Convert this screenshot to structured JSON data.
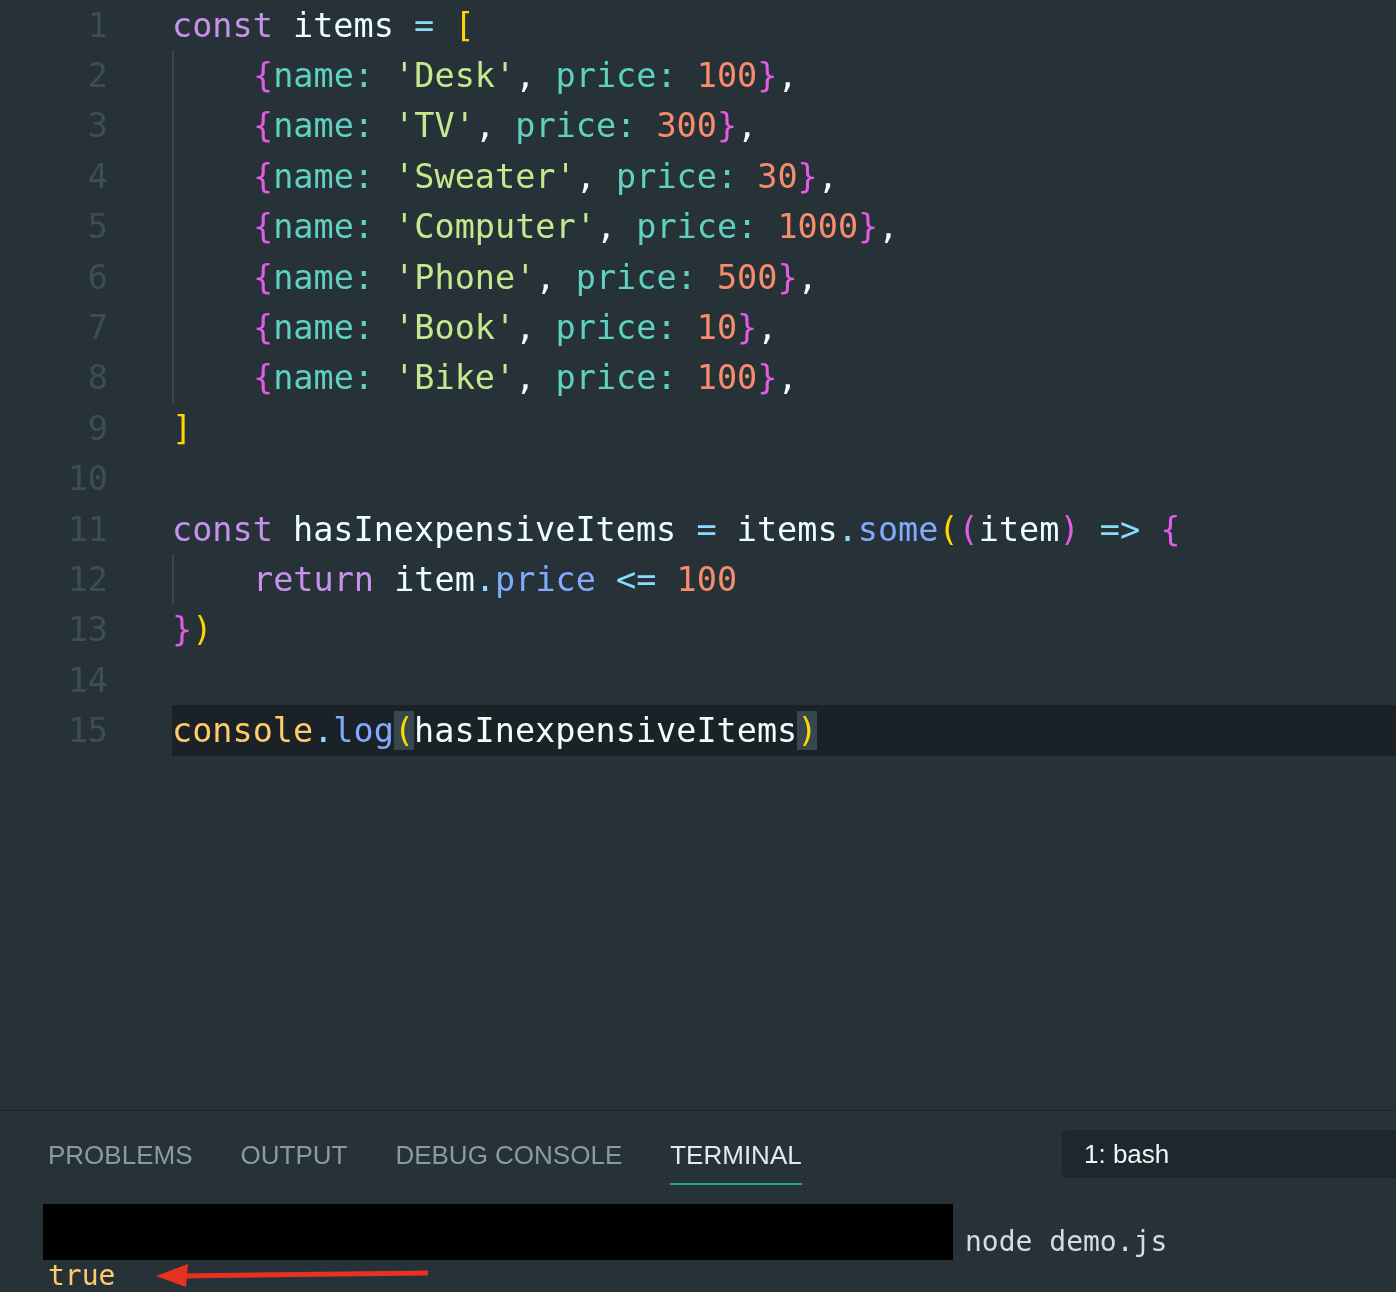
{
  "editor": {
    "lines": [
      {
        "number": "1",
        "current": false,
        "indented": false,
        "tokens": [
          {
            "text": "const ",
            "kind": "keyword"
          },
          {
            "text": "items ",
            "kind": "variable"
          },
          {
            "text": "= ",
            "kind": "operator"
          },
          {
            "text": "[",
            "kind": "bracket-yellow"
          }
        ]
      },
      {
        "number": "2",
        "current": false,
        "indented": true,
        "tokens": [
          {
            "text": "{",
            "kind": "bracket-pink"
          },
          {
            "text": "name: ",
            "kind": "property"
          },
          {
            "text": "'Desk'",
            "kind": "string"
          },
          {
            "text": ", ",
            "kind": "punct"
          },
          {
            "text": "price: ",
            "kind": "property"
          },
          {
            "text": "100",
            "kind": "number"
          },
          {
            "text": "}",
            "kind": "bracket-pink"
          },
          {
            "text": ",",
            "kind": "punct"
          }
        ]
      },
      {
        "number": "3",
        "current": false,
        "indented": true,
        "tokens": [
          {
            "text": "{",
            "kind": "bracket-pink"
          },
          {
            "text": "name: ",
            "kind": "property"
          },
          {
            "text": "'TV'",
            "kind": "string"
          },
          {
            "text": ", ",
            "kind": "punct"
          },
          {
            "text": "price: ",
            "kind": "property"
          },
          {
            "text": "300",
            "kind": "number"
          },
          {
            "text": "}",
            "kind": "bracket-pink"
          },
          {
            "text": ",",
            "kind": "punct"
          }
        ]
      },
      {
        "number": "4",
        "current": false,
        "indented": true,
        "tokens": [
          {
            "text": "{",
            "kind": "bracket-pink"
          },
          {
            "text": "name: ",
            "kind": "property"
          },
          {
            "text": "'Sweater'",
            "kind": "string"
          },
          {
            "text": ", ",
            "kind": "punct"
          },
          {
            "text": "price: ",
            "kind": "property"
          },
          {
            "text": "30",
            "kind": "number"
          },
          {
            "text": "}",
            "kind": "bracket-pink"
          },
          {
            "text": ",",
            "kind": "punct"
          }
        ]
      },
      {
        "number": "5",
        "current": false,
        "indented": true,
        "tokens": [
          {
            "text": "{",
            "kind": "bracket-pink"
          },
          {
            "text": "name: ",
            "kind": "property"
          },
          {
            "text": "'Computer'",
            "kind": "string"
          },
          {
            "text": ", ",
            "kind": "punct"
          },
          {
            "text": "price: ",
            "kind": "property"
          },
          {
            "text": "1000",
            "kind": "number"
          },
          {
            "text": "}",
            "kind": "bracket-pink"
          },
          {
            "text": ",",
            "kind": "punct"
          }
        ]
      },
      {
        "number": "6",
        "current": false,
        "indented": true,
        "tokens": [
          {
            "text": "{",
            "kind": "bracket-pink"
          },
          {
            "text": "name: ",
            "kind": "property"
          },
          {
            "text": "'Phone'",
            "kind": "string"
          },
          {
            "text": ", ",
            "kind": "punct"
          },
          {
            "text": "price: ",
            "kind": "property"
          },
          {
            "text": "500",
            "kind": "number"
          },
          {
            "text": "}",
            "kind": "bracket-pink"
          },
          {
            "text": ",",
            "kind": "punct"
          }
        ]
      },
      {
        "number": "7",
        "current": false,
        "indented": true,
        "tokens": [
          {
            "text": "{",
            "kind": "bracket-pink"
          },
          {
            "text": "name: ",
            "kind": "property"
          },
          {
            "text": "'Book'",
            "kind": "string"
          },
          {
            "text": ", ",
            "kind": "punct"
          },
          {
            "text": "price: ",
            "kind": "property"
          },
          {
            "text": "10",
            "kind": "number"
          },
          {
            "text": "}",
            "kind": "bracket-pink"
          },
          {
            "text": ",",
            "kind": "punct"
          }
        ]
      },
      {
        "number": "8",
        "current": false,
        "indented": true,
        "tokens": [
          {
            "text": "{",
            "kind": "bracket-pink"
          },
          {
            "text": "name: ",
            "kind": "property"
          },
          {
            "text": "'Bike'",
            "kind": "string"
          },
          {
            "text": ", ",
            "kind": "punct"
          },
          {
            "text": "price: ",
            "kind": "property"
          },
          {
            "text": "100",
            "kind": "number"
          },
          {
            "text": "}",
            "kind": "bracket-pink"
          },
          {
            "text": ",",
            "kind": "punct"
          }
        ]
      },
      {
        "number": "9",
        "current": false,
        "indented": false,
        "tokens": [
          {
            "text": "]",
            "kind": "bracket-yellow"
          }
        ]
      },
      {
        "number": "10",
        "current": false,
        "indented": false
      },
      {
        "number": "11",
        "current": false,
        "indented": false,
        "tokens": [
          {
            "text": "const ",
            "kind": "keyword"
          },
          {
            "text": "hasInexpensiveItems ",
            "kind": "variable"
          },
          {
            "text": "= ",
            "kind": "operator"
          },
          {
            "text": "items",
            "kind": "variable"
          },
          {
            "text": ".",
            "kind": "operator"
          },
          {
            "text": "some",
            "kind": "method"
          },
          {
            "text": "(",
            "kind": "bracket-yellow"
          },
          {
            "text": "(",
            "kind": "bracket-pink"
          },
          {
            "text": "item",
            "kind": "variable"
          },
          {
            "text": ") ",
            "kind": "bracket-pink"
          },
          {
            "text": "=> ",
            "kind": "operator"
          },
          {
            "text": "{",
            "kind": "bracket-pink"
          }
        ]
      },
      {
        "number": "12",
        "current": false,
        "indented": true,
        "tokens": [
          {
            "text": "return ",
            "kind": "keyword"
          },
          {
            "text": "item",
            "kind": "variable"
          },
          {
            "text": ".",
            "kind": "operator"
          },
          {
            "text": "price ",
            "kind": "method"
          },
          {
            "text": "<= ",
            "kind": "operator"
          },
          {
            "text": "100",
            "kind": "number"
          }
        ]
      },
      {
        "number": "13",
        "current": false,
        "indented": false,
        "tokens": [
          {
            "text": "}",
            "kind": "bracket-pink"
          },
          {
            "text": ")",
            "kind": "bracket-yellow"
          }
        ]
      },
      {
        "number": "14",
        "current": false,
        "indented": false
      },
      {
        "number": "15",
        "current": true,
        "indented": false,
        "tokens": [
          {
            "text": "console",
            "kind": "class"
          },
          {
            "text": ".",
            "kind": "operator"
          },
          {
            "text": "log",
            "kind": "method"
          },
          {
            "text": "(",
            "kind": "bracket-match"
          },
          {
            "text": "hasInexpensiveItems",
            "kind": "variable"
          },
          {
            "text": ")",
            "kind": "bracket-match"
          }
        ]
      }
    ]
  },
  "panel": {
    "tabs": [
      {
        "label": "PROBLEMS",
        "selected": false
      },
      {
        "label": "OUTPUT",
        "selected": false
      },
      {
        "label": "DEBUG CONSOLE",
        "selected": false
      },
      {
        "label": "TERMINAL",
        "selected": true
      }
    ],
    "terminal_selector": "1: bash",
    "terminal": {
      "command": "node demo.js",
      "output": "true"
    }
  }
}
